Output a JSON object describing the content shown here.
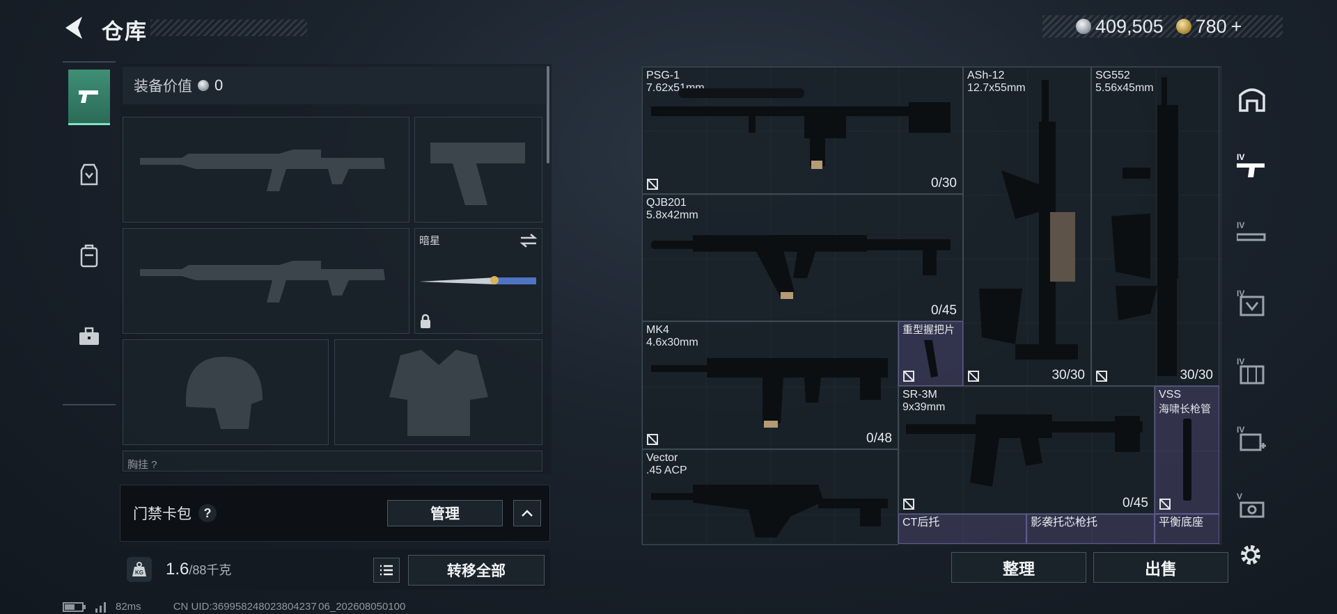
{
  "header": {
    "title": "仓库"
  },
  "currency": {
    "silver": "409,505",
    "gold": "780",
    "gold_plus": "+"
  },
  "equipment": {
    "value_label": "装备价值",
    "value": "0",
    "melee_name": "暗星",
    "next_section_label": "胸挂 ?"
  },
  "access_card": {
    "label": "门禁卡包",
    "help": "?",
    "manage": "管理"
  },
  "weight": {
    "current": "1.6",
    "max": "/88千克",
    "transfer_all": "转移全部"
  },
  "stash": {
    "items": [
      {
        "name": "PSG-1",
        "caliber": "7.62x51mm",
        "ammo": "0/30"
      },
      {
        "name": "ASh-12",
        "caliber": "12.7x55mm",
        "ammo": "30/30"
      },
      {
        "name": "SG552",
        "caliber": "5.56x45mm",
        "ammo": "30/30"
      },
      {
        "name": "QJB201",
        "caliber": "5.8x42mm",
        "ammo": "0/45"
      },
      {
        "name": "MK4",
        "caliber": "4.6x30mm",
        "ammo": "0/48"
      },
      {
        "name": "重型握把片",
        "caliber": "",
        "ammo": ""
      },
      {
        "name": "SR-3M",
        "caliber": "9x39mm",
        "ammo": "0/45"
      },
      {
        "name": "VSS",
        "caliber": "海啸长枪管",
        "ammo": ""
      },
      {
        "name": "Vector",
        "caliber": ".45 ACP",
        "ammo": ""
      },
      {
        "name": "CT后托",
        "caliber": "",
        "ammo": ""
      },
      {
        "name": "影袭托芯枪托",
        "caliber": "",
        "ammo": ""
      },
      {
        "name": "平衡底座",
        "caliber": "",
        "ammo": ""
      }
    ],
    "sort": "整理",
    "sell": "出售"
  },
  "right_tabs": [
    "IV",
    "IV",
    "IV",
    "IV",
    "IV",
    "V"
  ],
  "status": {
    "ping": "82ms",
    "uid": "CN UID:369958248023804237 06_202608050100"
  },
  "colors": {
    "accent": "#3f8f75",
    "purple_item": "#4a466e"
  }
}
